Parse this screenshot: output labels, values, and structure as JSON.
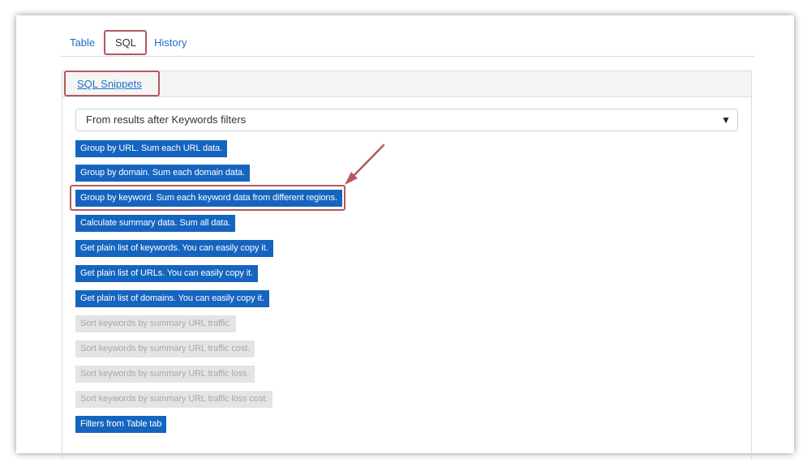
{
  "tabs": [
    {
      "label": "Table",
      "active": false
    },
    {
      "label": "SQL",
      "active": true
    },
    {
      "label": "History",
      "active": false
    }
  ],
  "panel": {
    "header_link": "SQL Snippets",
    "select": {
      "value": "From results after Keywords filters",
      "arrow_icon": "triangle-down-icon"
    },
    "snippets": [
      {
        "label": "Group by URL. Sum each URL data.",
        "enabled": true
      },
      {
        "label": "Group by domain. Sum each domain data.",
        "enabled": true
      },
      {
        "label": "Group by keyword. Sum each keyword data from different regions.",
        "enabled": true,
        "highlighted": true
      },
      {
        "label": "Calculate summary data. Sum all data.",
        "enabled": true
      },
      {
        "label": "Get plain list of keywords. You can easily copy it.",
        "enabled": true
      },
      {
        "label": "Get plain list of URLs. You can easily copy it.",
        "enabled": true
      },
      {
        "label": "Get plain list of domains. You can easily copy it.",
        "enabled": true
      },
      {
        "label": "Sort keywords by summary URL traffic.",
        "enabled": false
      },
      {
        "label": "Sort keywords by summary URL traffic cost.",
        "enabled": false
      },
      {
        "label": "Sort keywords by summary URL traffic loss.",
        "enabled": false
      },
      {
        "label": "Sort keywords by summary URL traffic loss cost.",
        "enabled": false
      },
      {
        "label": "Filters from Table tab",
        "enabled": true
      }
    ]
  },
  "colors": {
    "accent": "#1565c0",
    "link": "#1e6fc8",
    "highlight_border": "#b05a60",
    "disabled_bg": "#e4e4e4",
    "disabled_text": "#a9a9a9"
  }
}
